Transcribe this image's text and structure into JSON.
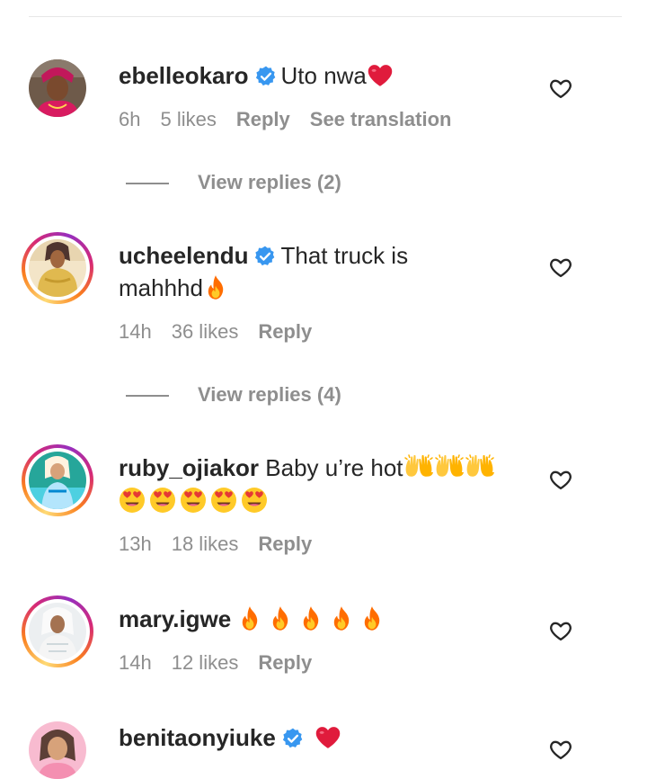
{
  "comments": [
    {
      "username": "ebelleokaro",
      "verified": true,
      "text": "Uto nwa",
      "time": "6h",
      "likes": "5 likes",
      "reply": "Reply",
      "translate": "See translation",
      "view_replies": "View replies (2)"
    },
    {
      "username": "ucheelendu",
      "verified": true,
      "text": "That truck is",
      "text2": "mahhhd",
      "time": "14h",
      "likes": "36 likes",
      "reply": "Reply",
      "view_replies": "View replies (4)"
    },
    {
      "username": "ruby_ojiakor",
      "verified": false,
      "text": "Baby u’re hot",
      "time": "13h",
      "likes": "18 likes",
      "reply": "Reply"
    },
    {
      "username": "mary.igwe",
      "verified": false,
      "text": "",
      "time": "14h",
      "likes": "12 likes",
      "reply": "Reply"
    },
    {
      "username": "benitaonyiuke",
      "verified": true,
      "text": ""
    }
  ],
  "colors": {
    "text": "#262626",
    "meta": "#8e8e8e",
    "verified": "#3897f0",
    "heart": "#ed4956",
    "fire": "#ff6f00"
  },
  "icons": [
    "verified-badge-icon",
    "heart-outline-icon",
    "red-heart-emoji",
    "fire-emoji",
    "raising-hands-emoji",
    "heart-eyes-emoji"
  ]
}
